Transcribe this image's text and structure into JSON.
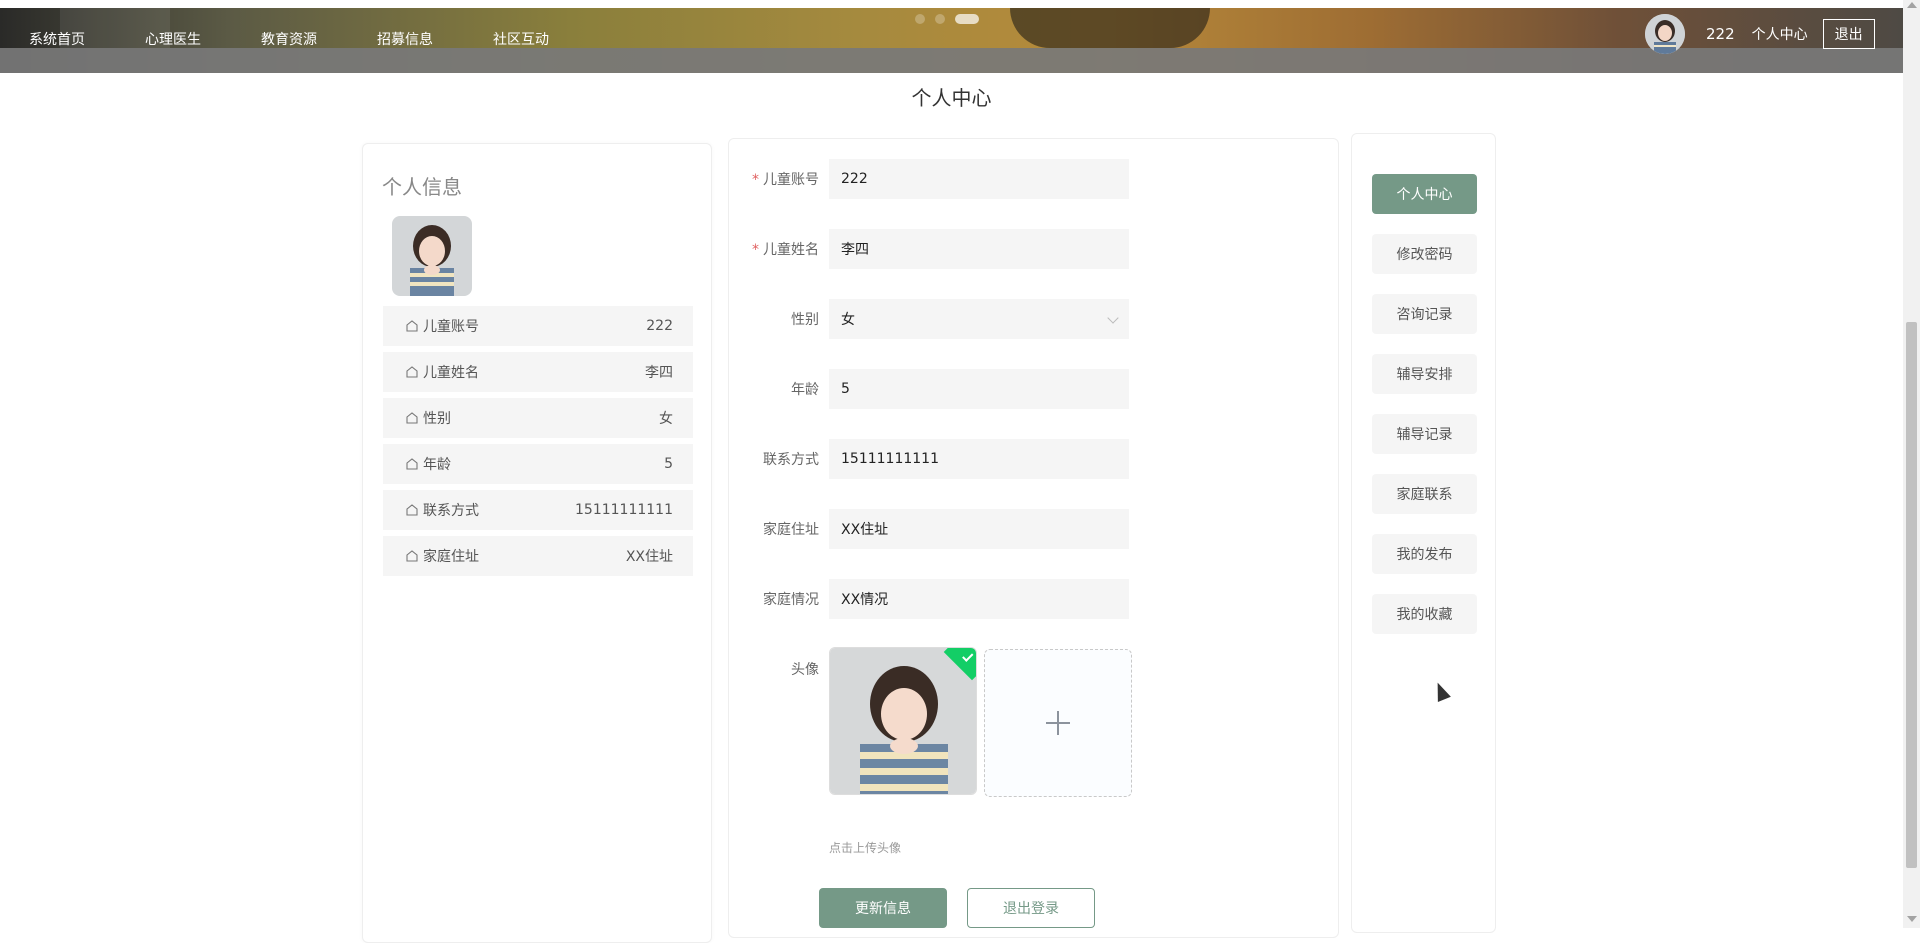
{
  "header": {
    "nav": [
      "系统首页",
      "心理医生",
      "教育资源",
      "招募信息",
      "社区互动"
    ],
    "user_name": "222",
    "user_center": "个人中心",
    "logout": "退出"
  },
  "page_title": "个人中心",
  "profile": {
    "title": "个人信息",
    "rows": [
      {
        "label": "儿童账号",
        "value": "222"
      },
      {
        "label": "儿童姓名",
        "value": "李四"
      },
      {
        "label": "性别",
        "value": "女"
      },
      {
        "label": "年龄",
        "value": "5"
      },
      {
        "label": "联系方式",
        "value": "15111111111"
      },
      {
        "label": "家庭住址",
        "value": "XX住址"
      }
    ]
  },
  "form": {
    "fields": [
      {
        "label": "儿童账号",
        "value": "222",
        "required": true
      },
      {
        "label": "儿童姓名",
        "value": "李四",
        "required": true
      },
      {
        "label": "性别",
        "value": "女",
        "required": false
      },
      {
        "label": "年龄",
        "value": "5",
        "required": false
      },
      {
        "label": "联系方式",
        "value": "15111111111",
        "required": false
      },
      {
        "label": "家庭住址",
        "value": "XX住址",
        "required": false
      },
      {
        "label": "家庭情况",
        "value": "XX情况",
        "required": false
      }
    ],
    "avatar_label": "头像",
    "upload_tip": "点击上传头像",
    "update_button": "更新信息",
    "logout_button": "退出登录"
  },
  "menu": [
    "个人中心",
    "修改密码",
    "咨询记录",
    "辅导安排",
    "辅导记录",
    "家庭联系",
    "我的发布",
    "我的收藏"
  ],
  "colors": {
    "accent": "#759987"
  }
}
